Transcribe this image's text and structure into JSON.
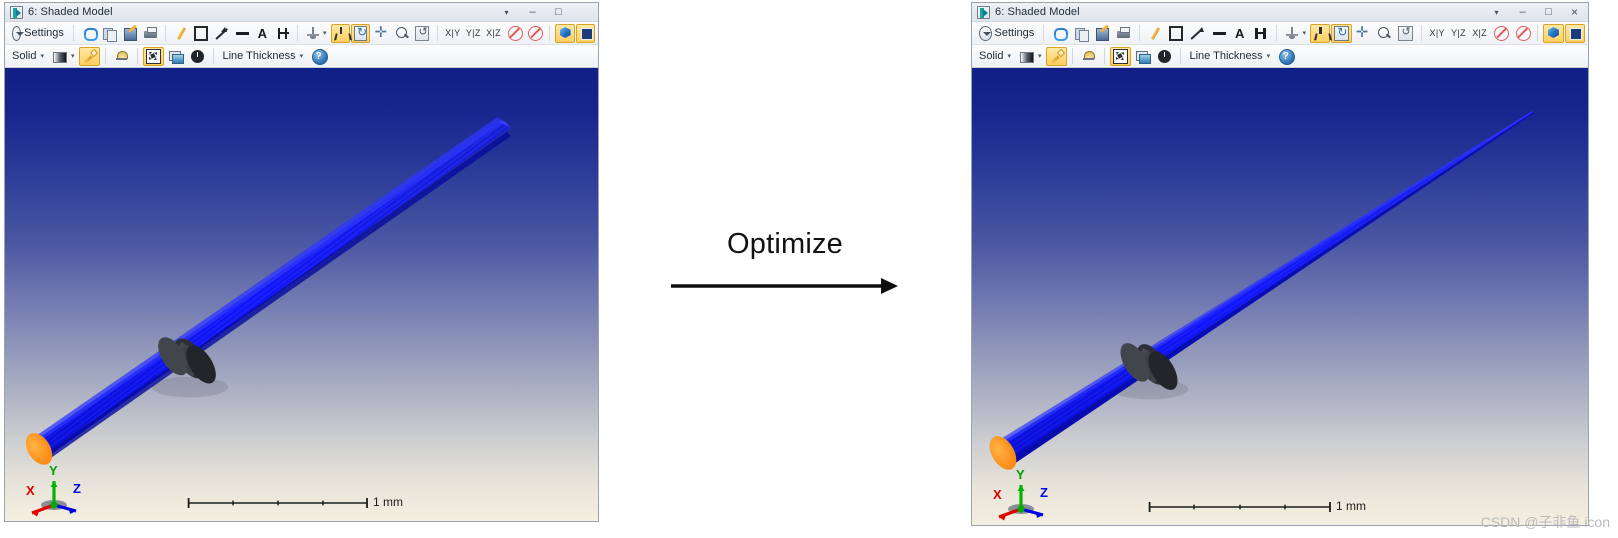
{
  "windows": [
    {
      "id": "left",
      "title": "6: Shaded Model",
      "app_icon": "shaded-model-icon",
      "window_controls": {
        "dropdown": "▾",
        "minimize": "–",
        "maximize": "□",
        "close": ""
      },
      "model": {
        "shape": "uniform-cantilever-beam",
        "beam_color": "#0a12ee",
        "tip_color": "#ff8a10",
        "collar_color": "#3c4046"
      },
      "scale_bar": {
        "label": "1 mm",
        "ticks": 5
      },
      "axis_triad": {
        "x": "X",
        "y": "Y",
        "z": "Z"
      }
    },
    {
      "id": "right",
      "title": "6: Shaded Model",
      "app_icon": "shaded-model-icon",
      "window_controls": {
        "dropdown": "▾",
        "minimize": "–",
        "maximize": "□",
        "close": "×"
      },
      "model": {
        "shape": "tapered-optimized-beam",
        "beam_color": "#0a12ee",
        "tip_color": "#ff8a10",
        "collar_color": "#3c4046"
      },
      "scale_bar": {
        "label": "1 mm",
        "ticks": 5
      },
      "axis_triad": {
        "x": "X",
        "y": "Y",
        "z": "Z"
      }
    }
  ],
  "toolbar": {
    "row1": {
      "settings_label": "Settings",
      "icons": [
        "settings-icon",
        "refresh-icon",
        "copy-icon",
        "save-chart-icon",
        "print-icon",
        "pencil-icon",
        "rectangle-icon",
        "arrow-icon",
        "line-icon",
        "text-icon",
        "dimension-icon",
        "view-axis-icon",
        "tripod-icon",
        "rotate-icon",
        "pan-icon",
        "zoom-icon",
        "reset-view-icon",
        "plane-xy-icon",
        "plane-yz-icon",
        "plane-xz-icon",
        "no-clip-icon",
        "no-mesh-icon",
        "cube-icon",
        "dark-square-icon"
      ],
      "text_tool_label": "A",
      "planes": [
        "X|Y",
        "Y|Z",
        "X|Z"
      ]
    },
    "row2": {
      "render_mode_label": "Solid",
      "line_thickness_label": "Line Thickness",
      "icons": [
        "gradient-swatch-icon",
        "flashlight-icon",
        "lamp-icon",
        "fit-view-icon",
        "copy-image-icon",
        "clock-icon",
        "help-icon"
      ]
    }
  },
  "center": {
    "label": "Optimize",
    "arrow": "right-arrow"
  },
  "watermark": "CSDN @子非鱼 icon",
  "colors": {
    "highlight": "#ffcf5e",
    "beam": "#0a12ee",
    "tip": "#ff8a10",
    "bg_top": "#0f1f86",
    "bg_bottom": "#f5efe0"
  }
}
